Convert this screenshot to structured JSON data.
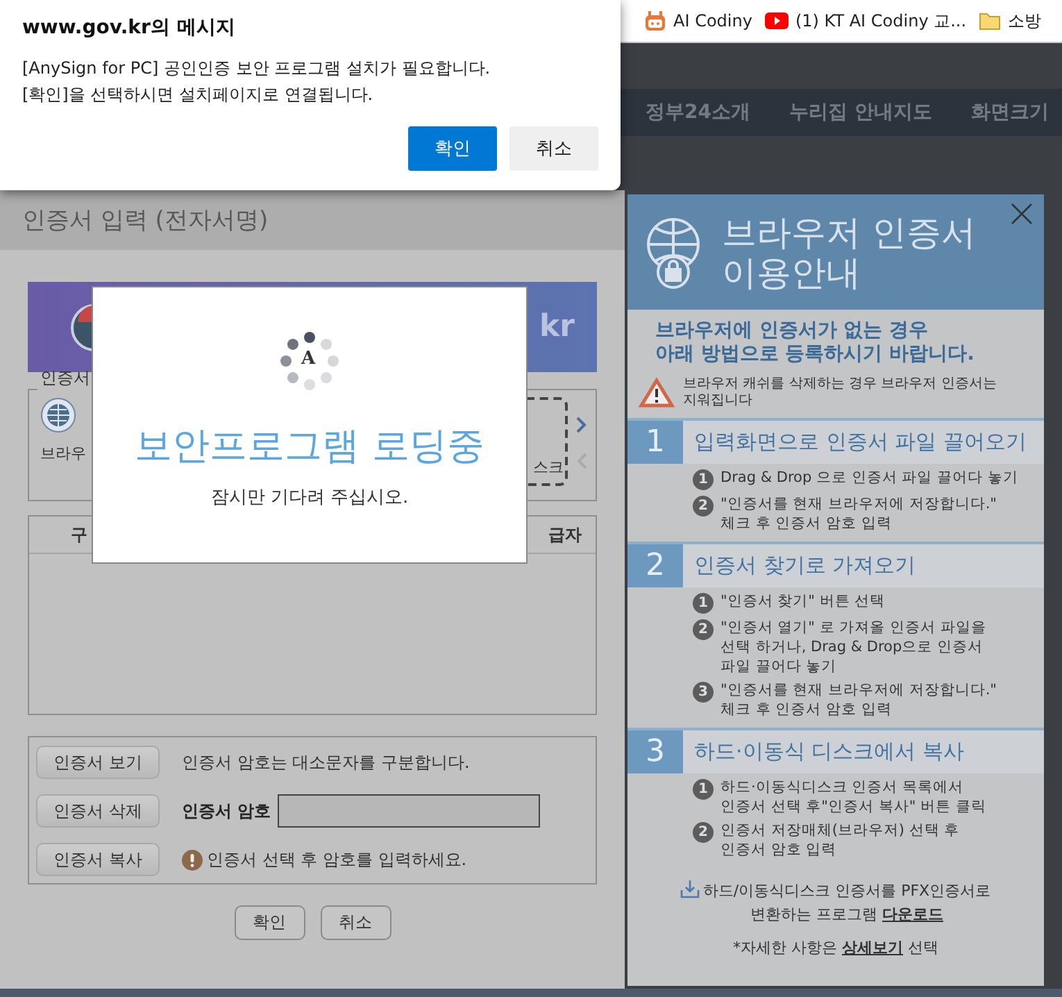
{
  "bookmarks": [
    {
      "kind": "app",
      "label": "AI Codiny"
    },
    {
      "kind": "video",
      "label": "(1) KT AI Codiny 교..."
    },
    {
      "kind": "folder",
      "label": "소방"
    }
  ],
  "nav": [
    "정부24소개",
    "누리집 안내지도",
    "화면크기"
  ],
  "alert": {
    "title": "www.gov.kr의 메시지",
    "lines": [
      "[AnySign for PC] 공인인증 보안 프로그램 설치가 필요합니다.",
      "[확인]을 선택하시면 설치페이지로 연결됩니다."
    ],
    "buttons": [
      {
        "label": "확인",
        "primary": true
      },
      {
        "label": "취소",
        "primary": false
      }
    ]
  },
  "cert_window": {
    "title": "인증서 입력 (전자서명)",
    "banner_text": "kr",
    "legend": "인증서",
    "location_label": "브라우",
    "disk_label": "스크",
    "carousel": {
      "next_disabled": false,
      "prev_disabled": true
    },
    "table_columns": [
      "구",
      "급자"
    ],
    "actions": [
      "인증서 보기",
      "인증서 삭제",
      "인증서 복사"
    ],
    "case_note": "인증서 암호는 대소문자를 구분합니다.",
    "password_label": "인증서 암호",
    "password_hint": "인증서 선택 후 암호를 입력하세요.",
    "buttons": [
      "확인",
      "취소"
    ]
  },
  "loading": {
    "logo_letter": "A",
    "title": "보안프로그램 로딩중",
    "message": "잠시만 기다려 주십시오."
  },
  "guide": {
    "title": "브라우저 인증서\n이용안내",
    "intro": "브라우저에 인증서가 없는 경우\n아래 방법으로 등록하시기 바랍니다.",
    "warning": "브라우저 캐쉬를 삭제하는 경우 브라우저 인증서는\n지워집니다",
    "steps": [
      {
        "number": "1",
        "title": "입력화면으로 인증서 파일 끌어오기",
        "items": [
          {
            "marker": "1",
            "text": "Drag & Drop 으로 인증서 파일 끌어다 놓기"
          },
          {
            "marker": "2",
            "text": "\"인증서를 현재 브라우저에 저장합니다.\"\n체크 후 인증서 암호 입력"
          }
        ]
      },
      {
        "number": "2",
        "title": "인증서 찾기로 가져오기",
        "items": [
          {
            "marker": "1",
            "text": "\"인증서 찾기\" 버튼 선택"
          },
          {
            "marker": "2",
            "text": "\"인증서 열기\" 로 가져올 인증서 파일을\n선택 하거나, Drag & Drop으로 인증서\n파일 끌어다 놓기"
          },
          {
            "marker": "3",
            "text": "\"인증서를 현재 브라우저에 저장합니다.\"\n체크 후 인증서 암호 입력"
          }
        ]
      },
      {
        "number": "3",
        "title": "하드·이동식 디스크에서 복사",
        "items": [
          {
            "marker": "1",
            "text": "하드·이동식디스크 인증서 목록에서\n인증서 선택 후\"인증서 복사\" 버튼 클릭"
          },
          {
            "marker": "2",
            "text": "인증서 저장매체(브라우저) 선택 후\n인증서 암호 입력"
          }
        ]
      }
    ],
    "download_text": "하드/이동식디스크 인증서를 PFX인증서로\n변환하는 프로그램 ",
    "download_link": "다운로드",
    "detail_prefix": "*자세한 사항은 ",
    "detail_link": "상세보기",
    "detail_suffix": " 선택"
  }
}
